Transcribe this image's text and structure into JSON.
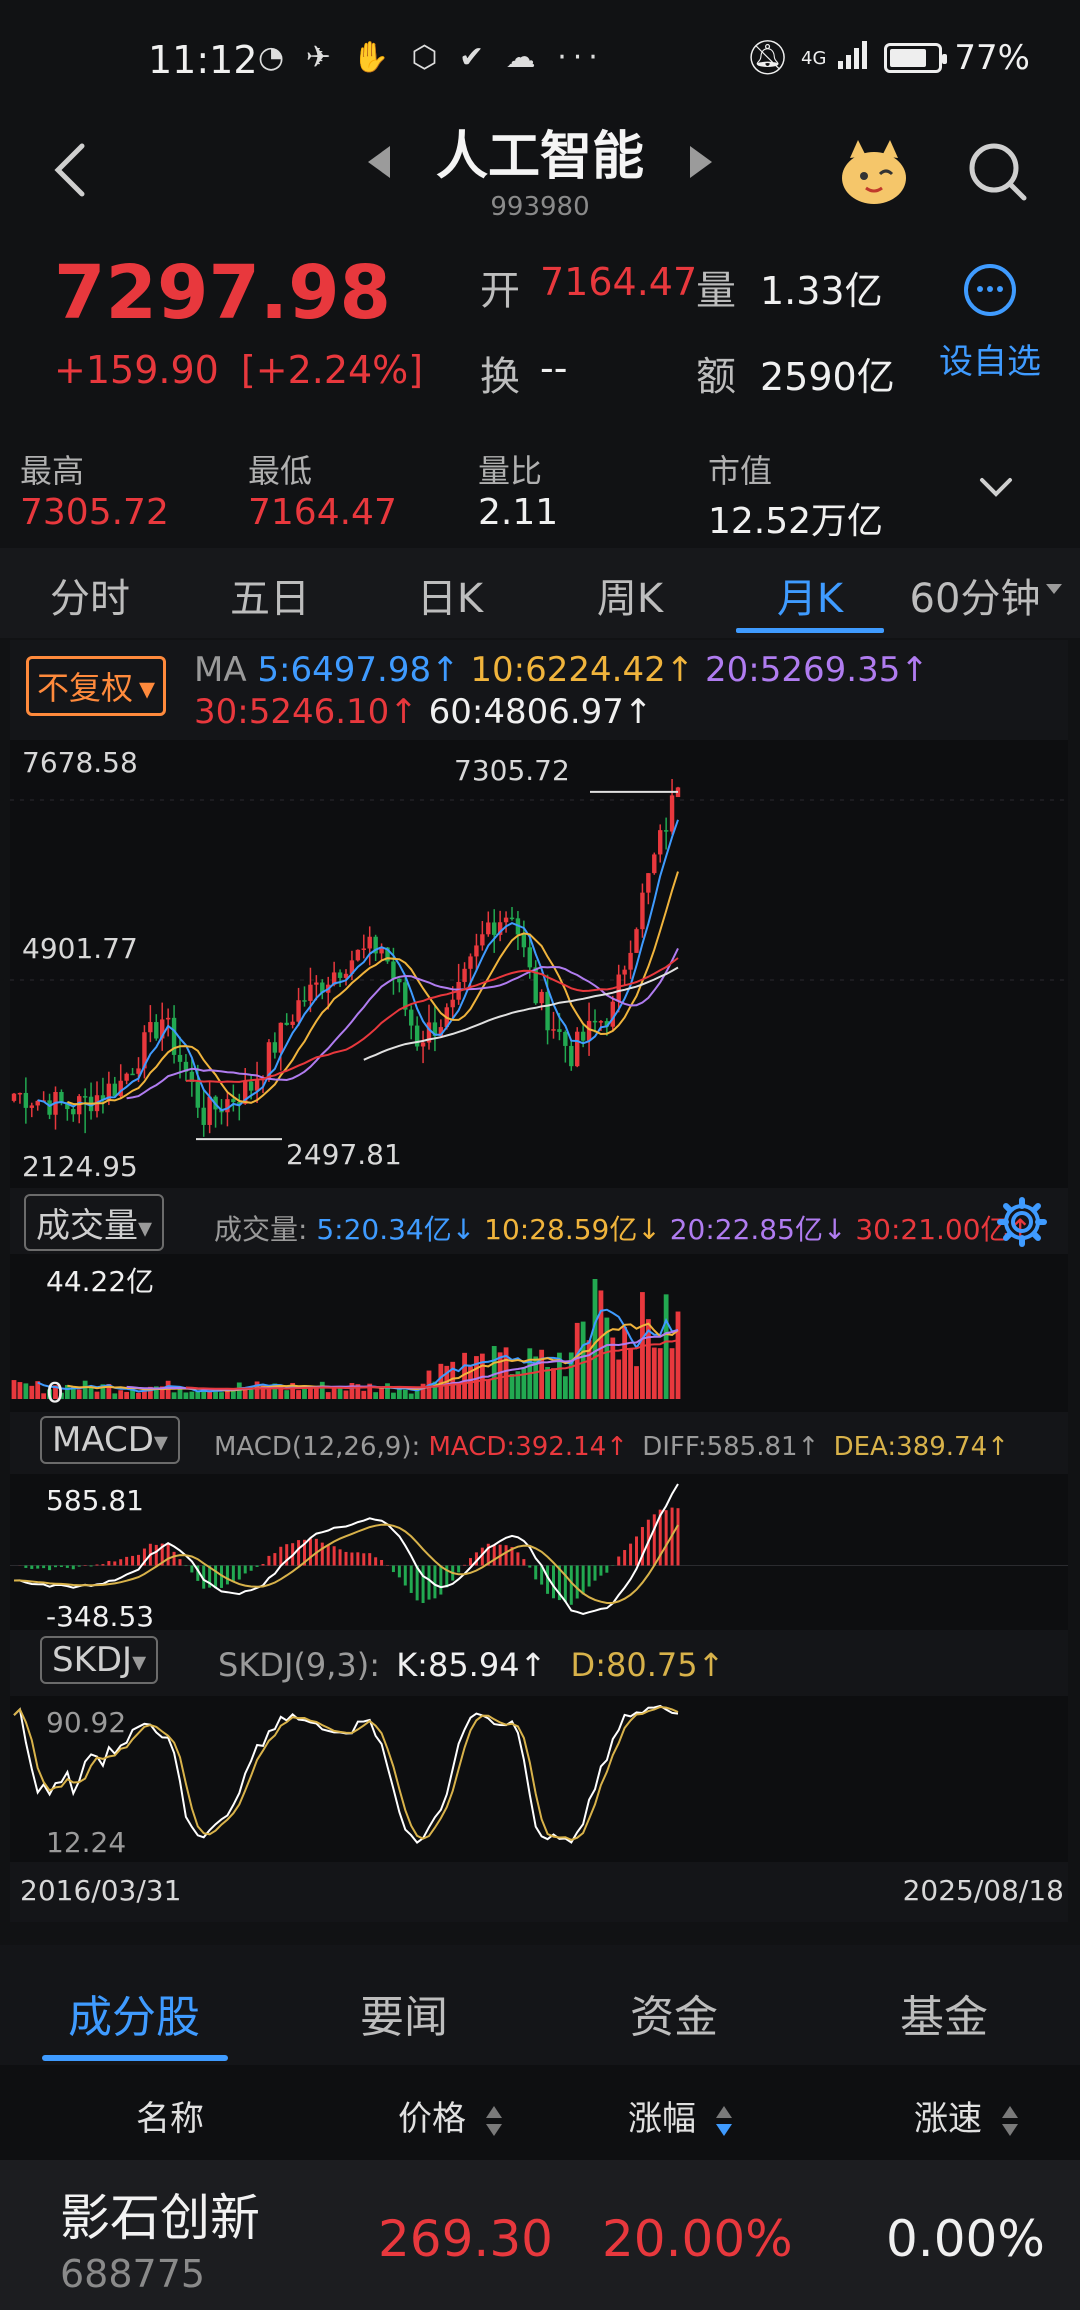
{
  "status": {
    "time": "11:12",
    "battery": "77%",
    "battery_level": 0.77,
    "network": "4G"
  },
  "titlebar": {
    "title": "人工智能",
    "code": "993980"
  },
  "quote": {
    "price": "7297.98",
    "change": "+159.90",
    "change_pct": "[+2.24%]",
    "open_label": "开",
    "open_val": "7164.47",
    "vol_label": "量",
    "vol_val": "1.33亿",
    "turnover_label": "换",
    "turnover_val": "--",
    "amount_label": "额",
    "amount_val": "2590亿",
    "fav_label": "设自选"
  },
  "stats": [
    {
      "label": "最高",
      "value": "7305.72"
    },
    {
      "label": "最低",
      "value": "7164.47"
    },
    {
      "label": "量比",
      "value": "2.11"
    },
    {
      "label": "市值",
      "value": "12.52万亿"
    }
  ],
  "period_tabs": [
    "分时",
    "五日",
    "日K",
    "周K",
    "月K",
    "60分钟"
  ],
  "period_active": 4,
  "main_chart": {
    "fq_label": "不复权",
    "ma_title": "MA",
    "ma5": "5:6497.98↑",
    "ma10": "10:6224.42↑",
    "ma20": "20:5269.35↑",
    "ma30": "30:5246.10↑",
    "ma60": "60:4806.97↑",
    "y_top": "7678.58",
    "y_mid": "4901.77",
    "y_bot": "2124.95",
    "hi_label": "7305.72",
    "lo_label": "2497.81"
  },
  "volume_panel": {
    "selector": "成交量",
    "title": "成交量:",
    "ma5": "5:20.34亿↓",
    "ma10": "10:28.59亿↓",
    "ma20": "20:22.85亿↓",
    "ma30": "30:21.00亿↑",
    "y_top": "44.22亿",
    "y_bot": "0"
  },
  "macd_panel": {
    "selector": "MACD",
    "title": "MACD(12,26,9):",
    "macd": "MACD:392.14↑",
    "diff": "DIFF:585.81↑",
    "dea": "DEA:389.74↑",
    "y_top": "585.81",
    "y_bot": "-348.53"
  },
  "skdj_panel": {
    "selector": "SKDJ",
    "title": "SKDJ(9,3):",
    "k": "K:85.94↑",
    "d": "D:80.75↑",
    "y_top": "90.92",
    "y_bot": "12.24"
  },
  "x_axis": {
    "start": "2016/03/31",
    "end": "2025/08/18"
  },
  "bottom_tabs": [
    "成分股",
    "要闻",
    "资金",
    "基金"
  ],
  "bottom_active": 0,
  "table": {
    "headers": [
      "名称",
      "价格",
      "涨幅",
      "涨速"
    ],
    "rows": [
      {
        "name": "影石创新",
        "code": "688775",
        "price": "269.30",
        "chg": "20.00%",
        "speed": "0.00%"
      }
    ]
  },
  "colors": {
    "up": "#e8383d",
    "down": "#22a951",
    "accent": "#3f9bff",
    "ma5": "#3f9bff",
    "ma10": "#f0b43c",
    "ma20": "#b07cf0",
    "ma30": "#e8383d",
    "ma60": "#e0e0e0"
  }
}
